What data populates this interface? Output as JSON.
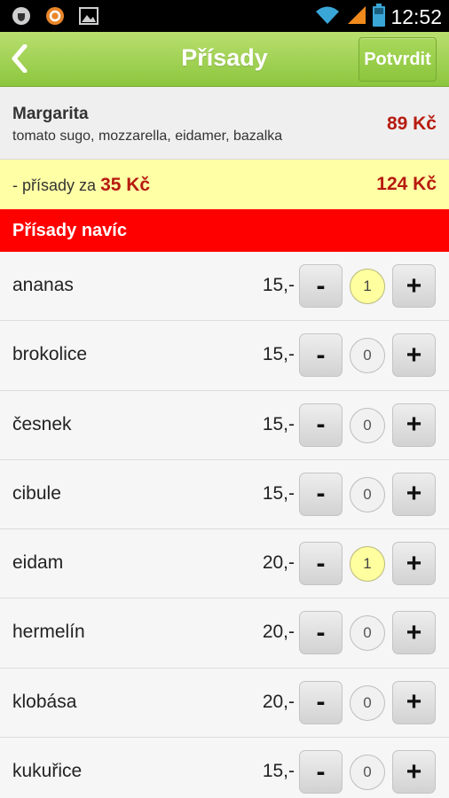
{
  "status_bar": {
    "time": "12:52",
    "icons": [
      "shield-icon",
      "app-icon",
      "image-icon",
      "wifi-icon",
      "signal-icon",
      "battery-icon"
    ]
  },
  "action_bar": {
    "back_icon": "chevron-left-icon",
    "title": "Přísady",
    "confirm_label": "Potvrdit"
  },
  "pizza": {
    "name": "Margarita",
    "description": "tomato sugo, mozzarella, eidamer, bazalka",
    "price": "89 Kč"
  },
  "extras": {
    "label": "- přísady za",
    "amount": "35 Kč",
    "total": "124 Kč"
  },
  "section": {
    "title": "Přísady navíc"
  },
  "ingredients": [
    {
      "name": "ananas",
      "price": "15,-",
      "qty": "1"
    },
    {
      "name": "brokolice",
      "price": "15,-",
      "qty": "0"
    },
    {
      "name": "česnek",
      "price": "15,-",
      "qty": "0"
    },
    {
      "name": "cibule",
      "price": "15,-",
      "qty": "0"
    },
    {
      "name": "eidam",
      "price": "20,-",
      "qty": "1"
    },
    {
      "name": "hermelín",
      "price": "20,-",
      "qty": "0"
    },
    {
      "name": "klobása",
      "price": "20,-",
      "qty": "0"
    },
    {
      "name": "kukuřice",
      "price": "15,-",
      "qty": "0"
    }
  ],
  "buttons": {
    "minus": "-",
    "plus": "+"
  },
  "colors": {
    "accent_green": "#8cc63e",
    "price_red": "#b71b10",
    "section_red": "#ff0000",
    "highlight_yellow": "#ffffa6"
  }
}
